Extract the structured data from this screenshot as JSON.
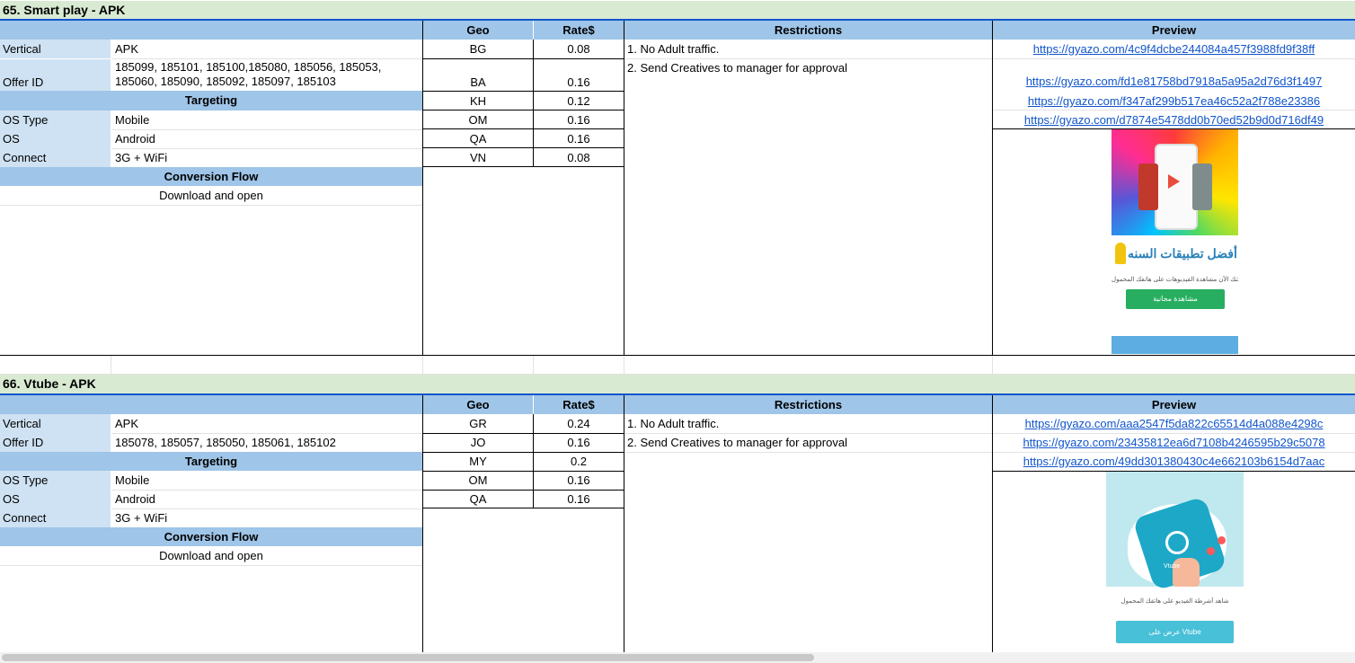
{
  "offers": [
    {
      "title": "65. Smart play - APK",
      "headers": {
        "geo": "Geo",
        "rate": "Rate$",
        "restrictions": "Restrictions",
        "preview": "Preview"
      },
      "vertical_label": "Vertical",
      "vertical": "APK",
      "offer_id_label": "Offer ID",
      "offer_id_lines": [
        "185099, 185101, 185100,185080, 185056, 185053,",
        "185060, 185090, 185092, 185097, 185103"
      ],
      "targeting": "Targeting",
      "os_type_label": "OS Type",
      "os_type": "Mobile",
      "os_label": "OS",
      "os": "Android",
      "connect_label": "Connect",
      "connect": "3G + WiFi",
      "conversion_flow": "Conversion Flow",
      "flow": "Download and open",
      "rates": [
        {
          "geo": "BG",
          "rate": "0.08"
        },
        {
          "geo": "BA",
          "rate": "0.16"
        },
        {
          "geo": "KH",
          "rate": "0.12"
        },
        {
          "geo": "OM",
          "rate": "0.16"
        },
        {
          "geo": "QA",
          "rate": "0.16"
        },
        {
          "geo": "VN",
          "rate": "0.08"
        }
      ],
      "restrictions": [
        "1. No Adult traffic.",
        "2. Send Creatives to manager for approval"
      ],
      "previews": [
        "https://gyazo.com/4c9f4dcbe244084a457f3988fd9f38ff",
        "https://gyazo.com/fd1e81758bd7918a5a95a2d76d3f1497",
        "https://gyazo.com/f347af299b517ea46c52a2f788e23386",
        "https://gyazo.com/d7874e5478dd0b70ed52b9d0d716df49"
      ],
      "creative": {
        "headline": "أفضل تطبيقات السنه",
        "subtext": "يمكنك الآن مشاهدة الفيديوهات على هاتفك المحمول",
        "button": "مشاهدة مجانية"
      }
    },
    {
      "title": "66. Vtube - APK",
      "headers": {
        "geo": "Geo",
        "rate": "Rate$",
        "restrictions": "Restrictions",
        "preview": "Preview"
      },
      "vertical_label": "Vertical",
      "vertical": "APK",
      "offer_id_label": "Offer ID",
      "offer_id_lines": [
        "185078, 185057, 185050, 185061, 185102"
      ],
      "targeting": "Targeting",
      "os_type_label": "OS Type",
      "os_type": "Mobile",
      "os_label": "OS",
      "os": "Android",
      "connect_label": "Connect",
      "connect": "3G + WiFi",
      "conversion_flow": "Conversion Flow",
      "flow": "Download and open",
      "rates": [
        {
          "geo": "GR",
          "rate": "0.24"
        },
        {
          "geo": "JO",
          "rate": "0.16"
        },
        {
          "geo": "MY",
          "rate": "0.2"
        },
        {
          "geo": "OM",
          "rate": "0.16"
        },
        {
          "geo": "QA",
          "rate": "0.16"
        }
      ],
      "restrictions": [
        "1. No Adult traffic.",
        "2. Send Creatives to manager for approval"
      ],
      "previews": [
        "https://gyazo.com/aaa2547f5da822c65514d4a088e4298c",
        "https://gyazo.com/23435812ea6d7108b4246595b29c5078",
        "https://gyazo.com/49dd301380430c4e662103b6154d7aac"
      ],
      "creative": {
        "headline": "Vtube",
        "subtext": "شاهد أشرطة الفيديو على هاتفك المحمول",
        "button": "عرض على Vtube"
      }
    }
  ],
  "colors": {
    "section_bg": "#d9ead3",
    "header_bg": "#9fc5e8",
    "label_bg": "#cfe2f3",
    "link": "#1155cc",
    "border": "#000000"
  }
}
